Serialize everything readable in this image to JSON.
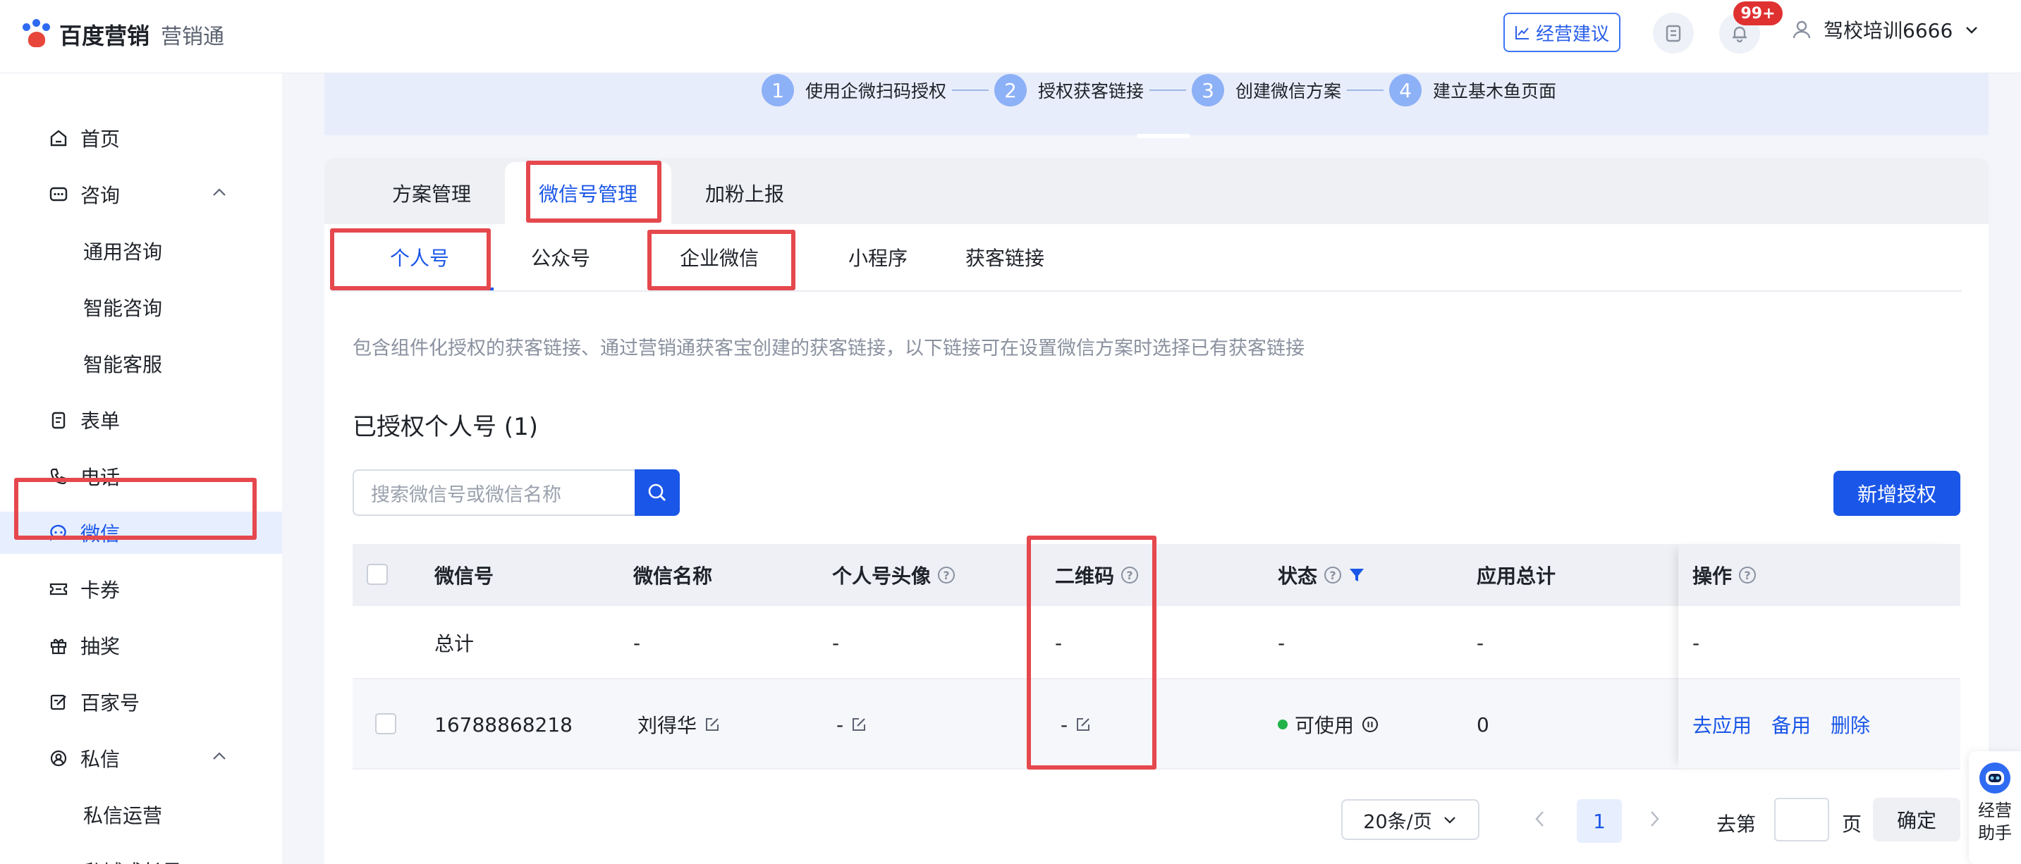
{
  "app": {
    "brand": "百度营销",
    "product": "营销通"
  },
  "header": {
    "advice_label": "经营建议",
    "notification_badge": "99+",
    "user_name": "驾校培训6666"
  },
  "sidebar": {
    "items": [
      {
        "label": "首页",
        "icon": "home-icon"
      },
      {
        "label": "咨询",
        "icon": "chat-icon",
        "expanded": true
      },
      {
        "label": "通用咨询"
      },
      {
        "label": "智能咨询"
      },
      {
        "label": "智能客服"
      },
      {
        "label": "表单",
        "icon": "form-icon"
      },
      {
        "label": "电话",
        "icon": "phone-icon"
      },
      {
        "label": "微信",
        "icon": "wechat-icon",
        "active": true
      },
      {
        "label": "卡券",
        "icon": "coupon-icon"
      },
      {
        "label": "抽奖",
        "icon": "gift-icon"
      },
      {
        "label": "百家号",
        "icon": "edit-icon"
      },
      {
        "label": "私信",
        "icon": "message-icon",
        "expanded": true
      },
      {
        "label": "私信运营"
      },
      {
        "label": "私域成长星"
      }
    ]
  },
  "steps": [
    {
      "num": "1",
      "label": "使用企微扫码授权"
    },
    {
      "num": "2",
      "label": "授权获客链接"
    },
    {
      "num": "3",
      "label": "创建微信方案"
    },
    {
      "num": "4",
      "label": "建立基木鱼页面"
    }
  ],
  "top_tabs": [
    {
      "label": "方案管理"
    },
    {
      "label": "微信号管理",
      "active": true
    },
    {
      "label": "加粉上报"
    }
  ],
  "sub_tabs": [
    {
      "label": "个人号",
      "active": true
    },
    {
      "label": "公众号"
    },
    {
      "label": "企业微信"
    },
    {
      "label": "小程序"
    },
    {
      "label": "获客链接"
    }
  ],
  "description": "包含组件化授权的获客链接、通过营销通获客宝创建的获客链接，以下链接可在设置微信方案时选择已有获客链接",
  "section_title": "已授权个人号 (1)",
  "search": {
    "placeholder": "搜索微信号或微信名称"
  },
  "add_button": "新增授权",
  "table": {
    "columns": {
      "wechat_id": "微信号",
      "wechat_name": "微信名称",
      "avatar": "个人号头像",
      "qrcode": "二维码",
      "status": "状态",
      "total": "应用总计",
      "action": "操作"
    },
    "total_row": {
      "label": "总计",
      "wechat_name": "-",
      "avatar": "-",
      "qrcode": "-",
      "status": "-",
      "total": "-",
      "action": "-"
    },
    "rows": [
      {
        "wechat_id": "16788868218",
        "wechat_name": "刘得华",
        "avatar": "-",
        "qrcode": "-",
        "status": "可使用",
        "total": "0",
        "actions": [
          "去应用",
          "备用",
          "删除"
        ]
      }
    ]
  },
  "pagination": {
    "page_size": "20条/页",
    "current_page": "1",
    "goto_prefix": "去第",
    "goto_suffix": "页",
    "confirm": "确定"
  },
  "assistant_label": "经营助手",
  "colors": {
    "accent": "#1a56e8",
    "highlight": "#e5484d",
    "status_ok": "#1fb34a",
    "badge": "#e03131"
  }
}
